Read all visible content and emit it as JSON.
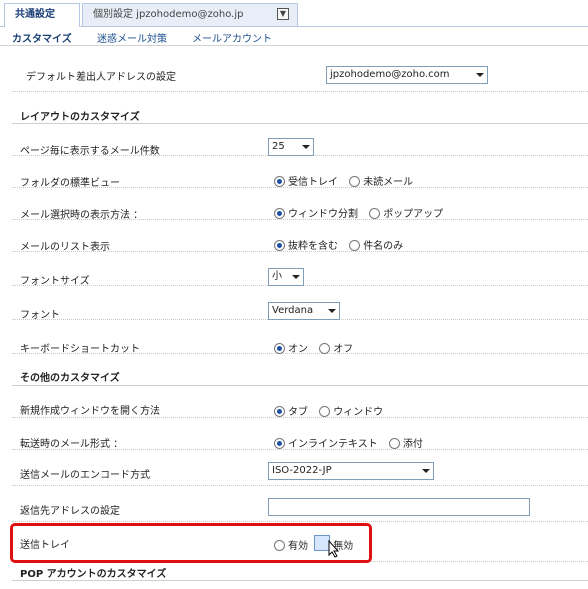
{
  "top_tabs": {
    "common": "共通設定",
    "individual": "個別設定 jpzohodemo@zoho.jp"
  },
  "sub_tabs": [
    "カスタマイズ",
    "迷惑メール対策",
    "メールアカウント"
  ],
  "default_sender": {
    "label": "デフォルト差出人アドレスの設定",
    "value": "jpzohodemo@zoho.com"
  },
  "sections": {
    "layout": "レイアウトのカスタマイズ",
    "other": "その他のカスタマイズ",
    "pop": "POP アカウントのカスタマイズ"
  },
  "settings": {
    "mails_per_page": {
      "label": "ページ毎に表示するメール件数",
      "value": "25"
    },
    "folder_view": {
      "label": "フォルダの標準ビュー",
      "opt1": "受信トレイ",
      "opt2": "未読メール",
      "selected": 1
    },
    "display_method": {
      "label": "メール選択時の表示方法 ：",
      "opt1": "ウィンドウ分割",
      "opt2": "ポップアップ",
      "selected": 1
    },
    "list_display": {
      "label": "メールのリスト表示",
      "opt1": "抜粋を含む",
      "opt2": "件名のみ",
      "selected": 1
    },
    "font_size": {
      "label": "フォントサイズ",
      "value": "小"
    },
    "font": {
      "label": "フォント",
      "value": "Verdana"
    },
    "keyboard_shortcut": {
      "label": "キーボードショートカット",
      "opt1": "オン",
      "opt2": "オフ",
      "selected": 1
    },
    "new_window": {
      "label": "新規作成ウィンドウを開く方法",
      "opt1": "タブ",
      "opt2": "ウィンドウ",
      "selected": 1
    },
    "forward_format": {
      "label": "転送時のメール形式 ：",
      "opt1": "インラインテキスト",
      "opt2": "添付",
      "selected": 1
    },
    "encoding": {
      "label": "送信メールのエンコード方式",
      "value": "ISO-2022-JP"
    },
    "reply_to": {
      "label": "返信先アドレスの設定",
      "value": ""
    },
    "sent_tray": {
      "label": "送信トレイ",
      "opt1": "有効",
      "opt2": "無効",
      "selected": 2
    }
  }
}
